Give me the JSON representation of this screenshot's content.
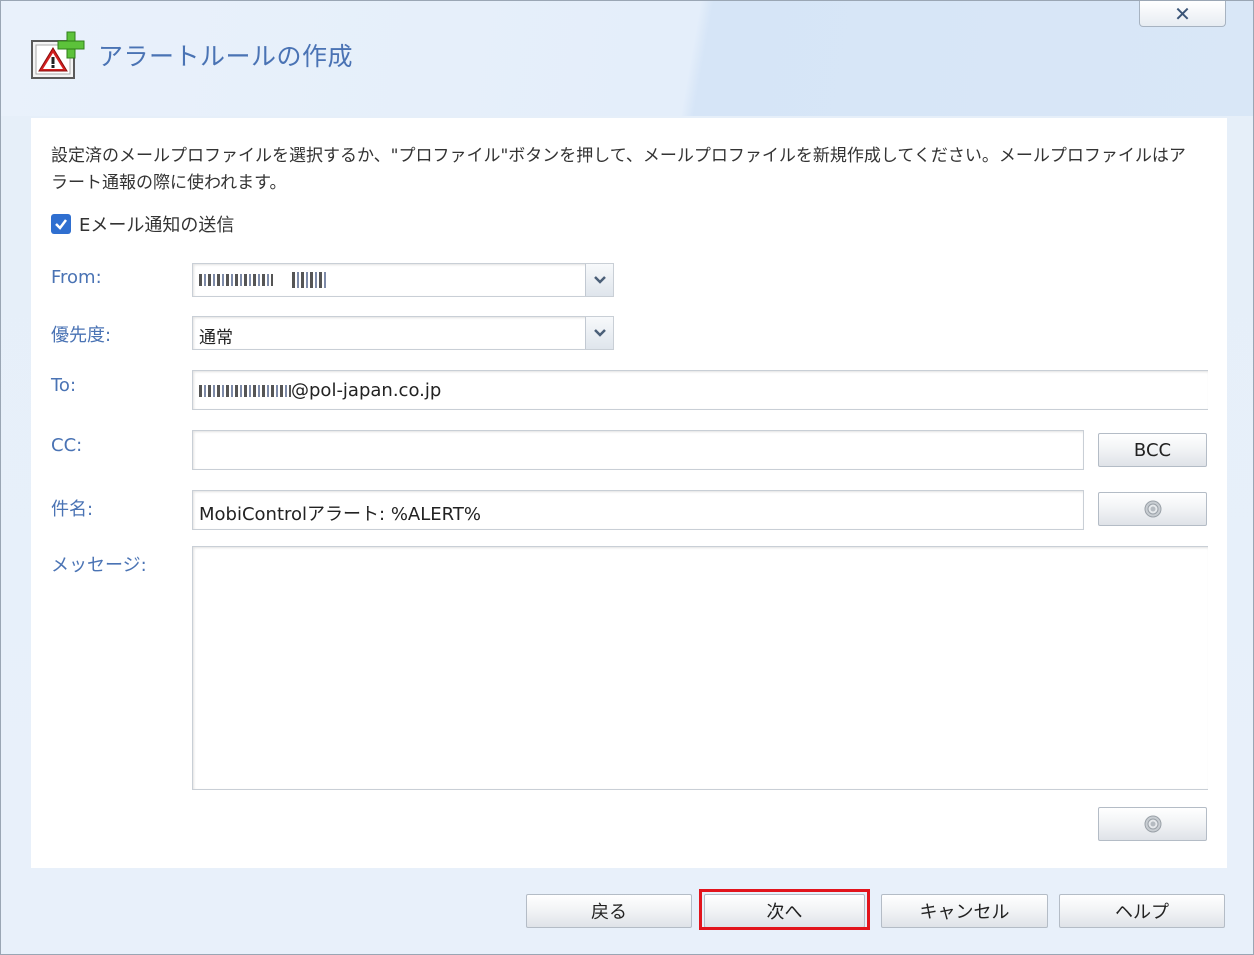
{
  "dialog": {
    "title": "アラートルールの作成",
    "close_label": "✕"
  },
  "description": "設定済のメールプロファイルを選択するか、\"プロファイル\"ボタンを押して、メールプロファイルを新規作成してください。メールプロファイルはアラート通報の際に使われます。",
  "email_notify": {
    "label": "Eメール通知の送信",
    "checked": true
  },
  "fields": {
    "from_label": "From:",
    "from_value": "",
    "priority_label": "優先度:",
    "priority_value": "通常",
    "to_label": "To:",
    "to_domain": "@pol-japan.co.jp",
    "cc_label": "CC:",
    "cc_value": "",
    "subject_label": "件名:",
    "subject_value": "MobiControlアラート: %ALERT%",
    "message_label": "メッセージ:",
    "message_value": ""
  },
  "buttons": {
    "bcc": "BCC",
    "back": "戻る",
    "next": "次へ",
    "cancel": "キャンセル",
    "help": "ヘルプ"
  },
  "colors": {
    "accent": "#4a73b4",
    "checkbox": "#2f6fd0",
    "highlight": "#e2141c"
  },
  "icons": {
    "title": "alert-rule-add-icon",
    "subject_macro": "gear-icon",
    "message_macro": "gear-icon"
  }
}
